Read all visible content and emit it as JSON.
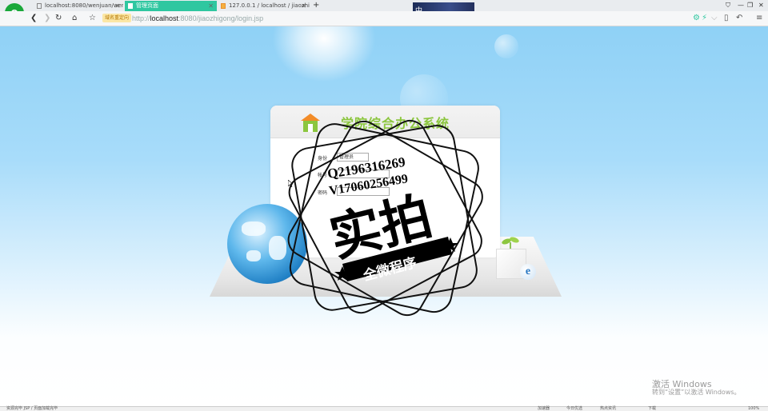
{
  "browser": {
    "tabs": [
      {
        "label": "localhost:8080/wenjuan/wenj",
        "active": false
      },
      {
        "label": "管理页面",
        "active": true
      },
      {
        "label": "127.0.0.1 / localhost / jiaozhi",
        "active": false
      }
    ],
    "new_tab": "+",
    "banner_text": "中",
    "security_badge": "域名重定向",
    "url_prefix": "http://",
    "url_host": "localhost",
    "url_rest": ":8080/jiaozhigong/login.jsp",
    "icons": [
      "back-icon",
      "forward-icon",
      "refresh-icon",
      "home-icon",
      "star-icon",
      "extension-icon",
      "menu-icon"
    ]
  },
  "login": {
    "title": "学院综合办公系统",
    "identity_label": "身份",
    "identity_value": "管理员",
    "account_label": "帐号",
    "password_label": "密码"
  },
  "watermark": {
    "line1": "Q2196316269",
    "line2": "V17060256499",
    "big": "实拍",
    "ribbon": "全微程序"
  },
  "activation": {
    "line1": "激活 Windows",
    "line2": "转到“设置”以激活 Windows。"
  },
  "status_bar": {
    "left": "资源完毕 JSP / 页面加载完毕",
    "items": [
      "加速器",
      "今日优选",
      "热点资讯",
      "下载",
      "100%"
    ]
  },
  "colors": {
    "tab_active": "#2fc7a0",
    "title_green": "#8cc63f",
    "sky_top": "#8fd1f6"
  }
}
